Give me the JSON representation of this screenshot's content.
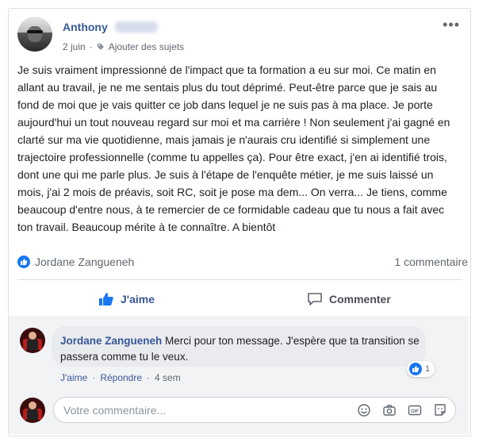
{
  "post": {
    "author": "Anthony",
    "date": "2 juin",
    "separator": "·",
    "topics_link": "Ajouter des sujets",
    "more": "•••",
    "text": "Je suis vraiment impressionné de l'impact que ta formation a eu sur moi. Ce matin en allant au travail, je ne me sentais plus du tout déprimé. Peut-être parce que je sais au fond de moi que je vais quitter ce job dans lequel je ne suis pas à ma place. Je porte aujourd'hui un tout nouveau regard sur moi et ma carrière ! Non seulement j'ai gagné en clarté sur ma vie quotidienne, mais jamais je n'aurais cru identifié si simplement une trajectoire professionnelle (comme tu appelles ça). Pour être exact, j'en ai identifié trois, dont une qui me parle plus. Je suis à l'étape de l'enquête métier, je me suis laissé un mois, j'ai 2 mois de préavis, soit RC, soit je pose ma dem... On verra... Je tiens, comme beaucoup d'entre nous, à te remercier de ce formidable cadeau que tu nous a fait avec ton travail. Beaucoup mérite à te connaître. A bientôt",
    "reactor": "Jordane Zangueneh",
    "comments_count": "1 commentaire"
  },
  "actions": {
    "like": "J'aime",
    "comment": "Commenter"
  },
  "comment": {
    "author": "Jordane Zangueneh",
    "text": "Merci pour ton message. J'espère que ta transition se passera comme tu le veux.",
    "reaction_count": "1",
    "like": "J'aime",
    "reply": "Répondre",
    "sep": "·",
    "time": "4 sem"
  },
  "composer": {
    "placeholder": "Votre commentaire..."
  },
  "colors": {
    "link_blue": "#385898",
    "like_blue": "#1877f2",
    "muted": "#606770"
  }
}
